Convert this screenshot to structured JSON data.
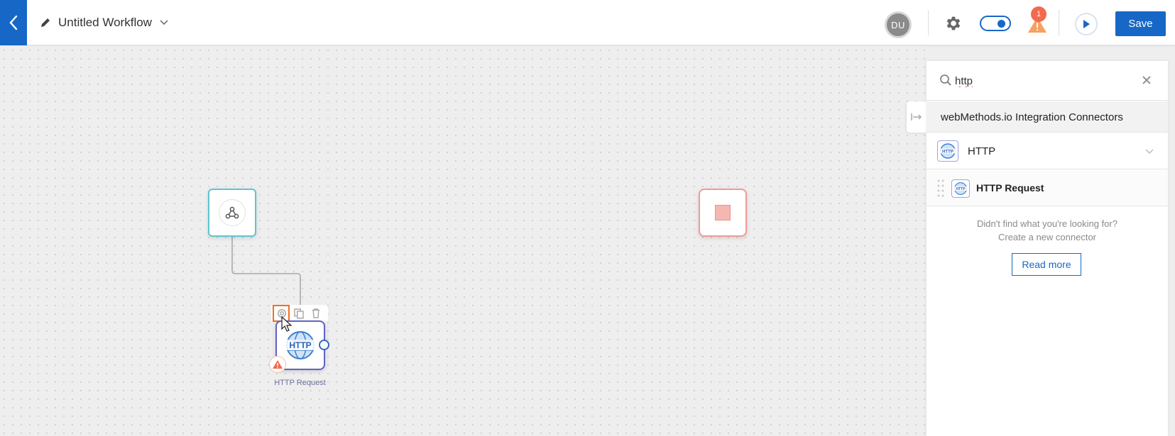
{
  "header": {
    "workflow_title": "Untitled Workflow",
    "avatar_initials": "DU",
    "notification_count": "1",
    "save_label": "Save"
  },
  "canvas": {
    "http_node_label": "HTTP Request",
    "http_node_icon_text": "HTTP"
  },
  "panel": {
    "search_value": "http",
    "section_title": "webMethods.io Integration Connectors",
    "group_label": "HTTP",
    "group_icon_text": "HTTP",
    "item_label": "HTTP Request",
    "item_icon_text": "HTTP",
    "help_line1": "Didn't find what you're looking for?",
    "help_line2": "Create a new connector",
    "read_more_label": "Read more"
  },
  "colors": {
    "brand_blue": "#1767c7",
    "trigger_border": "#5ec5d1",
    "end_border": "#f29b93",
    "warning_orange": "#f26a4f",
    "selection_highlight": "#f36f1f"
  },
  "icons": [
    "chevron-left-icon",
    "pencil-icon",
    "chevron-down-icon",
    "gear-icon",
    "toggle-switch",
    "warning-icon",
    "play-icon",
    "webhook-icon",
    "stop-icon",
    "copy-icon",
    "trash-icon",
    "http-globe-icon",
    "search-icon",
    "close-icon",
    "collapse-panel-icon",
    "drag-handle-icon"
  ]
}
